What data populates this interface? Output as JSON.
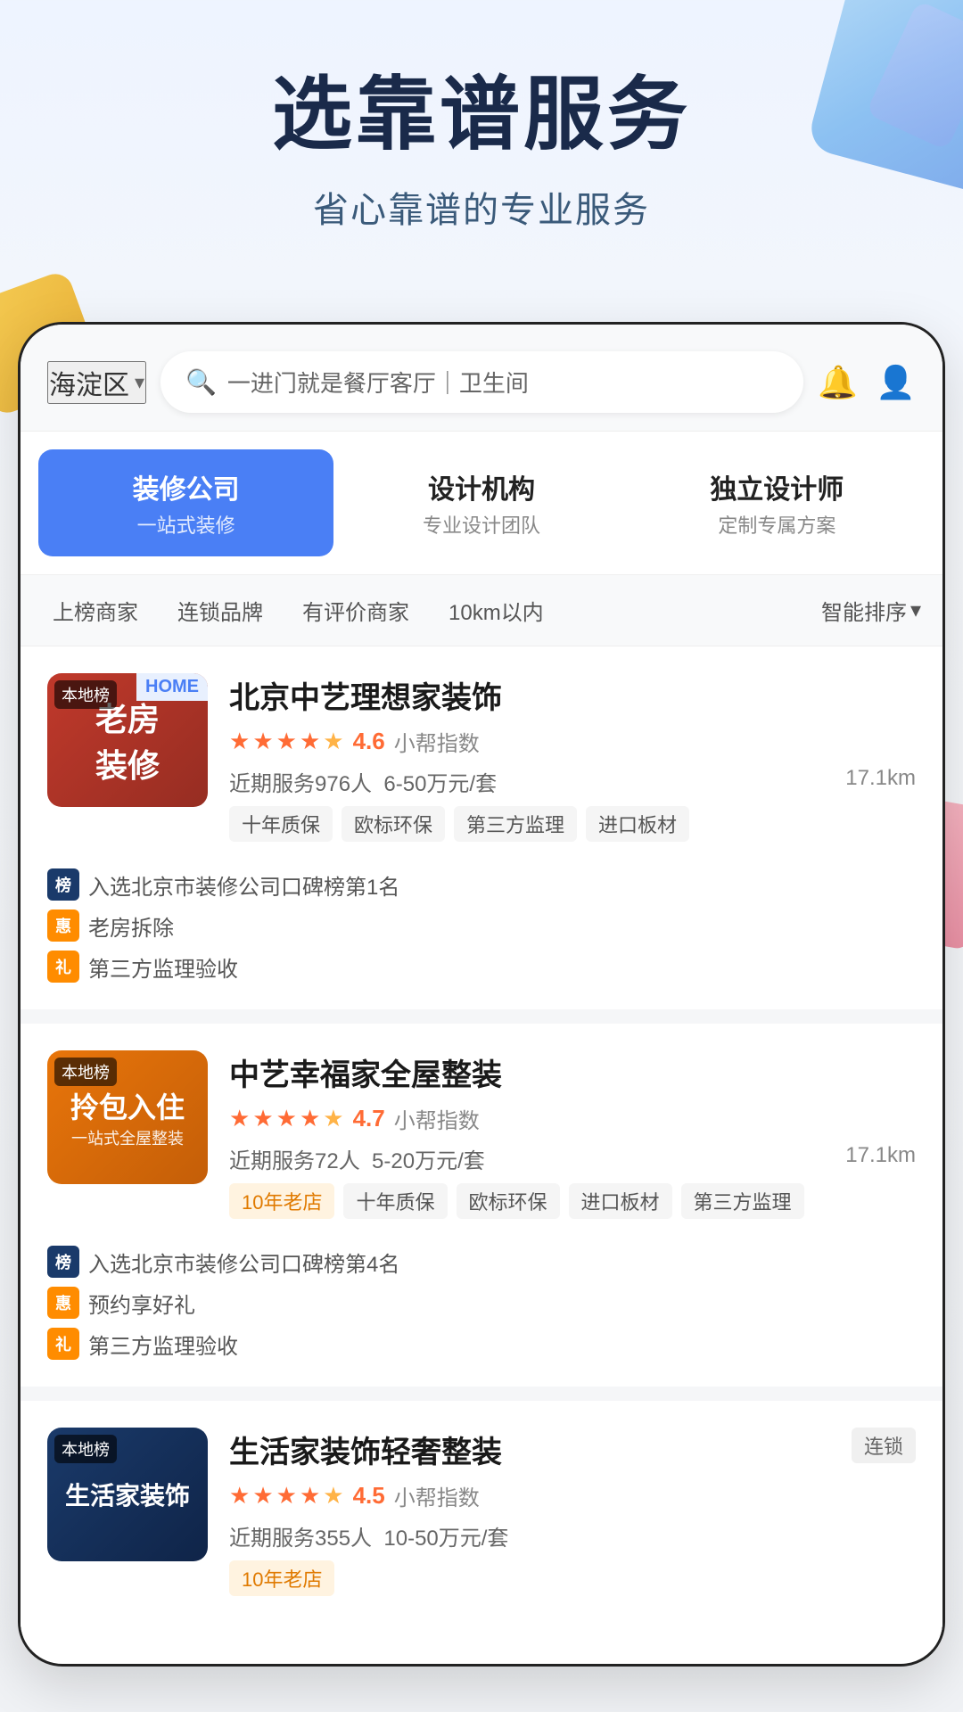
{
  "hero": {
    "title": "选靠谱服务",
    "subtitle": "省心靠谱的专业服务"
  },
  "search": {
    "location": "海淀区",
    "placeholder": "一进门就是餐厅客厅｜卫生间"
  },
  "categories": [
    {
      "id": "renovation",
      "main": "装修公司",
      "sub": "一站式装修",
      "active": true
    },
    {
      "id": "design-firm",
      "main": "设计机构",
      "sub": "专业设计团队",
      "active": false
    },
    {
      "id": "designer",
      "main": "独立设计师",
      "sub": "定制专属方案",
      "active": false
    }
  ],
  "filters": [
    "上榜商家",
    "连锁品牌",
    "有评价商家",
    "10km以内",
    "智能排序"
  ],
  "listings": [
    {
      "name": "北京中艺理想家装饰",
      "rating": "4.6",
      "rating_label": "小帮指数",
      "recent_service": "近期服务976人",
      "price_range": "6-50万元/套",
      "distance": "17.1km",
      "tags": [
        "十年质保",
        "欧标环保",
        "第三方监理",
        "进口板材"
      ],
      "thumb_label": "老房装修",
      "thumb_top_badge": "本地榜",
      "badges": [
        {
          "type": "rank",
          "icon": "榜",
          "text": "入选北京市装修公司口碑榜第1名"
        },
        {
          "type": "hui",
          "icon": "惠",
          "text": "老房拆除"
        },
        {
          "type": "li",
          "icon": "礼",
          "text": "第三方监理验收"
        }
      ],
      "stars": 4.5,
      "chain": false
    },
    {
      "name": "中艺幸福家全屋整装",
      "rating": "4.7",
      "rating_label": "小帮指数",
      "recent_service": "近期服务72人",
      "price_range": "5-20万元/套",
      "distance": "17.1km",
      "tags": [
        "10年老店",
        "十年质保",
        "欧标环保",
        "进口板材",
        "第三方监理"
      ],
      "thumb_label": "拎包入住",
      "thumb_sub": "一站式全屋整装",
      "thumb_top_badge": "本地榜",
      "badges": [
        {
          "type": "rank",
          "icon": "榜",
          "text": "入选北京市装修公司口碑榜第4名"
        },
        {
          "type": "hui",
          "icon": "惠",
          "text": "预约享好礼"
        },
        {
          "type": "li",
          "icon": "礼",
          "text": "第三方监理验收"
        }
      ],
      "stars": 4.5,
      "chain": false
    },
    {
      "name": "生活家装饰轻奢整装",
      "rating": "4.5",
      "rating_label": "小帮指数",
      "recent_service": "近期服务355人",
      "price_range": "10-50万元/套",
      "distance": "",
      "tags": [
        "10年老店"
      ],
      "thumb_label": "生活家装饰",
      "thumb_top_badge": "本地榜",
      "badges": [],
      "stars": 4.5,
      "chain": true
    }
  ],
  "icons": {
    "search": "🔍",
    "bell": "🔔",
    "user": "👤",
    "chevron": "▾",
    "sort": "⇅"
  }
}
